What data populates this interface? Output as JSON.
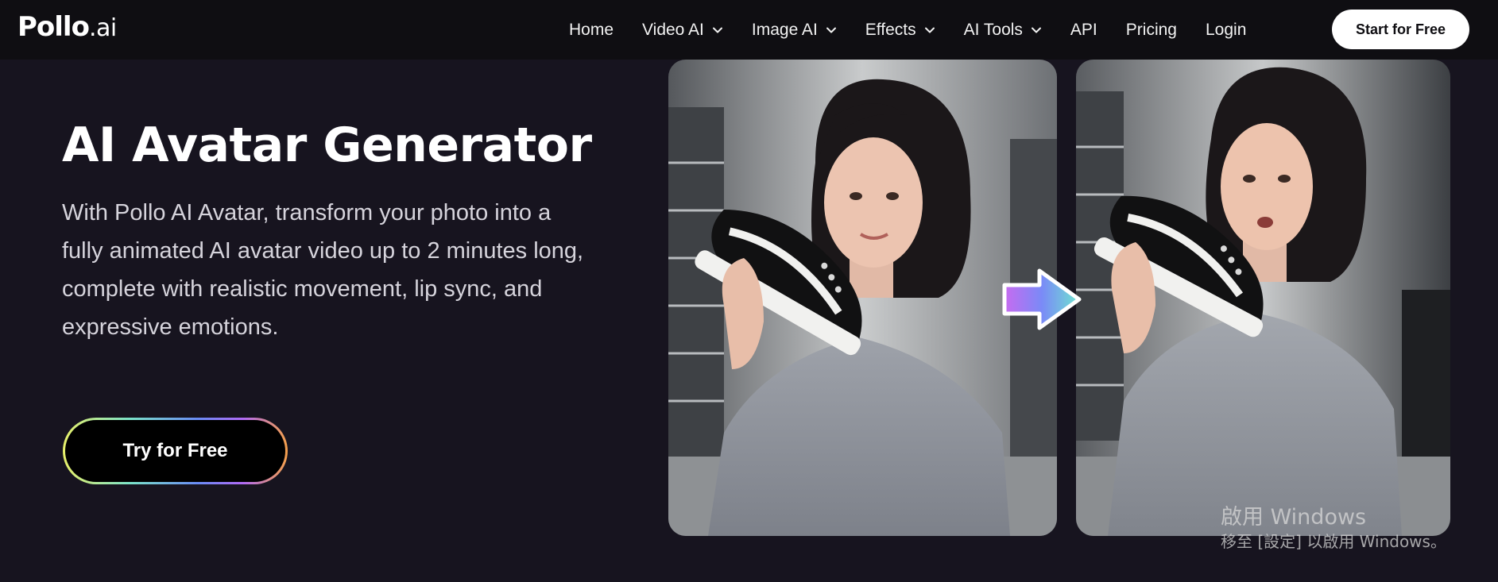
{
  "brand": {
    "name": "Pollo",
    "tld": ".ai"
  },
  "nav": {
    "items": [
      {
        "label": "Home",
        "dropdown": false
      },
      {
        "label": "Video AI",
        "dropdown": true
      },
      {
        "label": "Image AI",
        "dropdown": true
      },
      {
        "label": "Effects",
        "dropdown": true
      },
      {
        "label": "AI Tools",
        "dropdown": true
      },
      {
        "label": "API",
        "dropdown": false
      },
      {
        "label": "Pricing",
        "dropdown": false
      },
      {
        "label": "Login",
        "dropdown": false
      }
    ],
    "cta_label": "Start for Free"
  },
  "hero": {
    "title": "AI Avatar Generator",
    "description": "With Pollo AI Avatar, transform your photo into a fully animated AI avatar video up to 2 minutes long, complete with realistic movement, lip sync, and expressive emotions.",
    "cta_label": "Try for Free"
  },
  "watermark": {
    "line1": "啟用 Windows",
    "line2": "移至 [設定] 以啟用 Windows。"
  },
  "colors": {
    "page_bg": "#17141f",
    "nav_bg": "#0f0e12",
    "text_primary": "#ffffff",
    "text_secondary": "#d6d4dc"
  },
  "icons": {
    "dropdown": "chevron-down-icon",
    "transform_arrow": "arrow-right-icon"
  }
}
